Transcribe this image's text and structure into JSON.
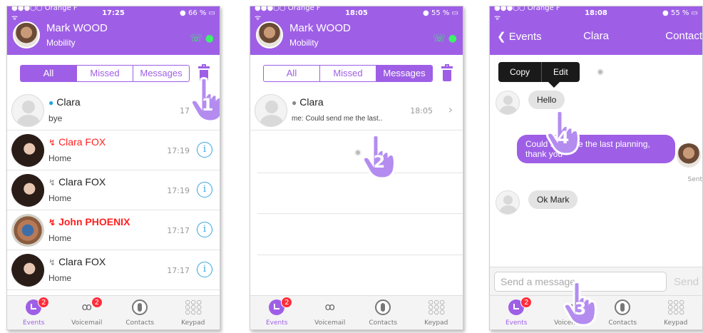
{
  "colors": {
    "accent": "#9e5fe6",
    "missed": "#ff2020",
    "info": "#36a6de",
    "badge": "#ff2d3a",
    "online": "#3ef06a"
  },
  "phone1": {
    "status": {
      "carrier": "●●●○○ Orange F ᯤ",
      "time": "17:25",
      "battery": "● 66 % ▭"
    },
    "header": {
      "name": "Mark WOOD",
      "subtitle": "Mobility"
    },
    "segments": [
      "All",
      "Missed",
      "Messages"
    ],
    "active_segment": "All",
    "rows": [
      {
        "name": "Clara",
        "detail": "bye",
        "time": "17",
        "icon": "chat-bubble-icon"
      },
      {
        "name": "Clara FOX",
        "detail": "Home",
        "time": "17:19",
        "icon": "missed-call-icon",
        "missed": true
      },
      {
        "name": "Clara FOX",
        "detail": "Home",
        "time": "17:19",
        "icon": "incoming-call-icon"
      },
      {
        "name": "John PHOENIX",
        "detail": "Home",
        "time": "17:17",
        "icon": "missed-call-icon",
        "missed": true
      },
      {
        "name": "Clara FOX",
        "detail": "Home",
        "time": "17:17",
        "icon": "incoming-call-icon"
      }
    ],
    "step": "1"
  },
  "phone2": {
    "status": {
      "carrier": "●●●○○ Orange F ᯤ",
      "time": "18:05",
      "battery": "● 55 % ▭"
    },
    "header": {
      "name": "Mark WOOD",
      "subtitle": "Mobility"
    },
    "segments": [
      "All",
      "Missed",
      "Messages"
    ],
    "active_segment": "Messages",
    "row": {
      "name": "Clara",
      "detail": "me: Could send me the last..",
      "time": "18:05"
    },
    "step": "2"
  },
  "phone3": {
    "status": {
      "carrier": "●●●○○ Orange F ᯤ",
      "time": "18:08",
      "battery": "● 55 % ▭"
    },
    "back_label": "Events",
    "title": "Clara",
    "contact_label": "Contact",
    "context_menu": [
      "Copy",
      "Edit"
    ],
    "messages": [
      {
        "text": "Hello",
        "dir": "in"
      },
      {
        "text": "Could send me the last planning, thank you",
        "dir": "out"
      },
      {
        "text": "Ok Mark",
        "dir": "in"
      }
    ],
    "sent_label": "Sent",
    "composer_placeholder": "Send a message",
    "send_label": "Send",
    "steps": [
      "3",
      "4"
    ]
  },
  "tabbar": {
    "tabs": [
      {
        "label": "Events",
        "icon": "events-clock-icon",
        "badge": "2"
      },
      {
        "label": "Voicemail",
        "icon": "voicemail-icon",
        "badge": "2"
      },
      {
        "label": "Contacts",
        "icon": "contacts-icon"
      },
      {
        "label": "Keypad",
        "icon": "keypad-icon"
      }
    ]
  }
}
